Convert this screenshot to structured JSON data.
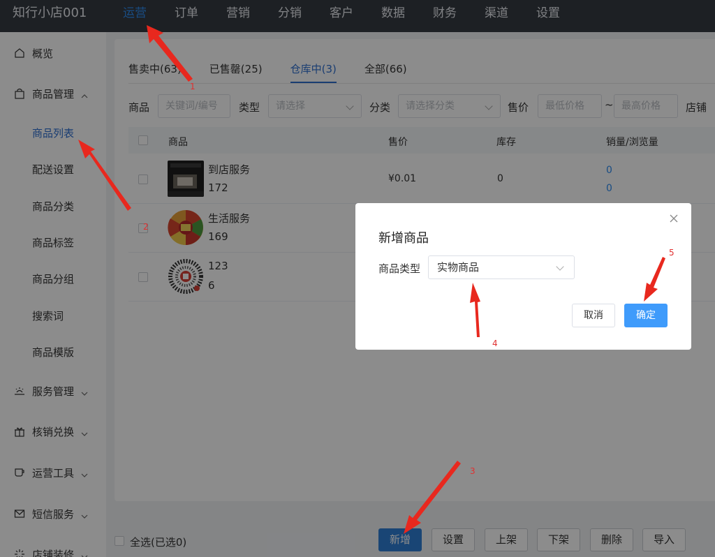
{
  "topbar": {
    "brand": "知行小店001",
    "nav": [
      "运营",
      "订单",
      "营销",
      "分销",
      "客户",
      "数据",
      "财务",
      "渠道",
      "设置"
    ],
    "active_index": 0
  },
  "sidebar": {
    "overview": "概览",
    "product_mgmt": "商品管理",
    "sub_items": [
      "商品列表",
      "配送设置",
      "商品分类",
      "商品标签",
      "商品分组",
      "搜索词",
      "商品模版"
    ],
    "service_mgmt": "服务管理",
    "verify_exchange": "核销兑换",
    "ops_tools": "运营工具",
    "sms_service": "短信服务",
    "store_decor": "店铺装修"
  },
  "tabs": [
    "售卖中(63)",
    "已售罄(25)",
    "仓库中(3)",
    "全部(66)"
  ],
  "active_tab": 2,
  "filters": {
    "product_label": "商品",
    "product_placeholder": "关键词/编号",
    "type_label": "类型",
    "type_placeholder": "请选择",
    "category_label": "分类",
    "category_placeholder": "请选择分类",
    "price_label": "售价",
    "min_price": "最低价格",
    "tilde": "~",
    "max_price": "最高价格",
    "store_label": "店铺"
  },
  "table": {
    "headers": [
      "商品",
      "售价",
      "库存",
      "销量/浏览量"
    ],
    "rows": [
      {
        "name": "到店服务",
        "number": "172",
        "price": "¥0.01",
        "stock": "0",
        "sales": "0",
        "views": "0"
      },
      {
        "name": "生活服务",
        "number": "169",
        "price": "",
        "stock": "",
        "sales": "",
        "views": ""
      },
      {
        "name": "123",
        "number": "6",
        "price": "",
        "stock": "",
        "sales": "",
        "views": ""
      }
    ]
  },
  "modal": {
    "title": "新增商品",
    "type_label": "商品类型",
    "type_value": "实物商品",
    "cancel": "取消",
    "confirm": "确定"
  },
  "bottom": {
    "select_all": "全选(已选0)",
    "buttons": [
      "新增",
      "设置",
      "上架",
      "下架",
      "删除",
      "导入"
    ]
  },
  "annotations": [
    "1",
    "2",
    "3",
    "4",
    "5"
  ],
  "colors": {
    "topbar_bg": "#353b43",
    "accent": "#2f8cf0",
    "primary_button": "#3f9bfb",
    "annotation_red": "#e03030"
  }
}
